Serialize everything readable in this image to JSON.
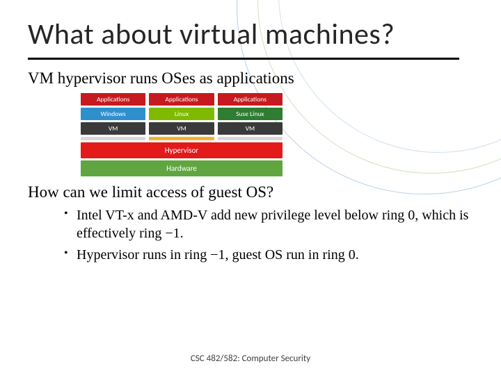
{
  "title": "What about virtual machines?",
  "lead": "VM hypervisor runs OSes as applications",
  "diagram": {
    "apps": [
      "Applications",
      "Applications",
      "Applications"
    ],
    "os": [
      "Windows",
      "Linux",
      "Suse Linux"
    ],
    "vm": [
      "VM",
      "VM",
      "VM"
    ],
    "hypervisor": "Hypervisor",
    "hardware": "Hardware"
  },
  "question2": "How can we limit access of guest OS?",
  "bullets": [
    "Intel VT-x and AMD-V add new privilege level below ring 0, which is effectively ring −1.",
    "Hypervisor runs in ring −1, guest OS run in ring 0."
  ],
  "footer": "CSC 482/582: Computer Security"
}
